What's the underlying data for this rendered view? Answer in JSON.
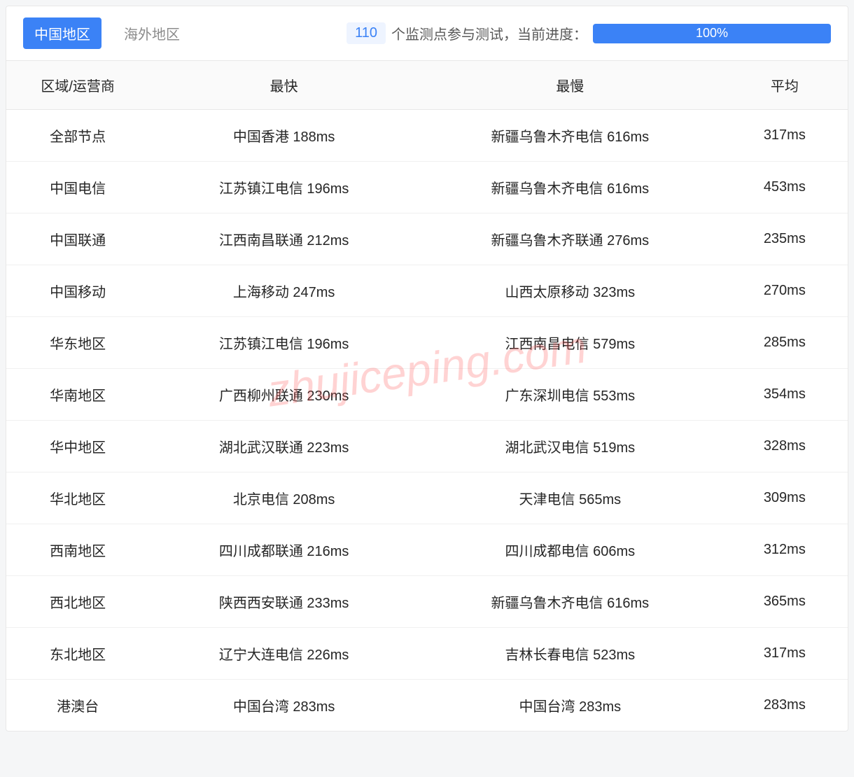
{
  "tabs": {
    "active": "中国地区",
    "inactive": "海外地区"
  },
  "status": {
    "count": "110",
    "text": "个监测点参与测试，当前进度：",
    "progress": "100%"
  },
  "watermark": "zhujiceping.com",
  "table": {
    "headers": [
      "区域/运营商",
      "最快",
      "最慢",
      "平均"
    ],
    "rows": [
      {
        "region": "全部节点",
        "fastest": "中国香港 188ms",
        "slowest": "新疆乌鲁木齐电信 616ms",
        "avg": "317ms"
      },
      {
        "region": "中国电信",
        "fastest": "江苏镇江电信 196ms",
        "slowest": "新疆乌鲁木齐电信 616ms",
        "avg": "453ms"
      },
      {
        "region": "中国联通",
        "fastest": "江西南昌联通 212ms",
        "slowest": "新疆乌鲁木齐联通 276ms",
        "avg": "235ms"
      },
      {
        "region": "中国移动",
        "fastest": "上海移动 247ms",
        "slowest": "山西太原移动 323ms",
        "avg": "270ms"
      },
      {
        "region": "华东地区",
        "fastest": "江苏镇江电信 196ms",
        "slowest": "江西南昌电信 579ms",
        "avg": "285ms"
      },
      {
        "region": "华南地区",
        "fastest": "广西柳州联通 230ms",
        "slowest": "广东深圳电信 553ms",
        "avg": "354ms"
      },
      {
        "region": "华中地区",
        "fastest": "湖北武汉联通 223ms",
        "slowest": "湖北武汉电信 519ms",
        "avg": "328ms"
      },
      {
        "region": "华北地区",
        "fastest": "北京电信 208ms",
        "slowest": "天津电信 565ms",
        "avg": "309ms"
      },
      {
        "region": "西南地区",
        "fastest": "四川成都联通 216ms",
        "slowest": "四川成都电信 606ms",
        "avg": "312ms"
      },
      {
        "region": "西北地区",
        "fastest": "陕西西安联通 233ms",
        "slowest": "新疆乌鲁木齐电信 616ms",
        "avg": "365ms"
      },
      {
        "region": "东北地区",
        "fastest": "辽宁大连电信 226ms",
        "slowest": "吉林长春电信 523ms",
        "avg": "317ms"
      },
      {
        "region": "港澳台",
        "fastest": "中国台湾 283ms",
        "slowest": "中国台湾 283ms",
        "avg": "283ms"
      }
    ]
  }
}
